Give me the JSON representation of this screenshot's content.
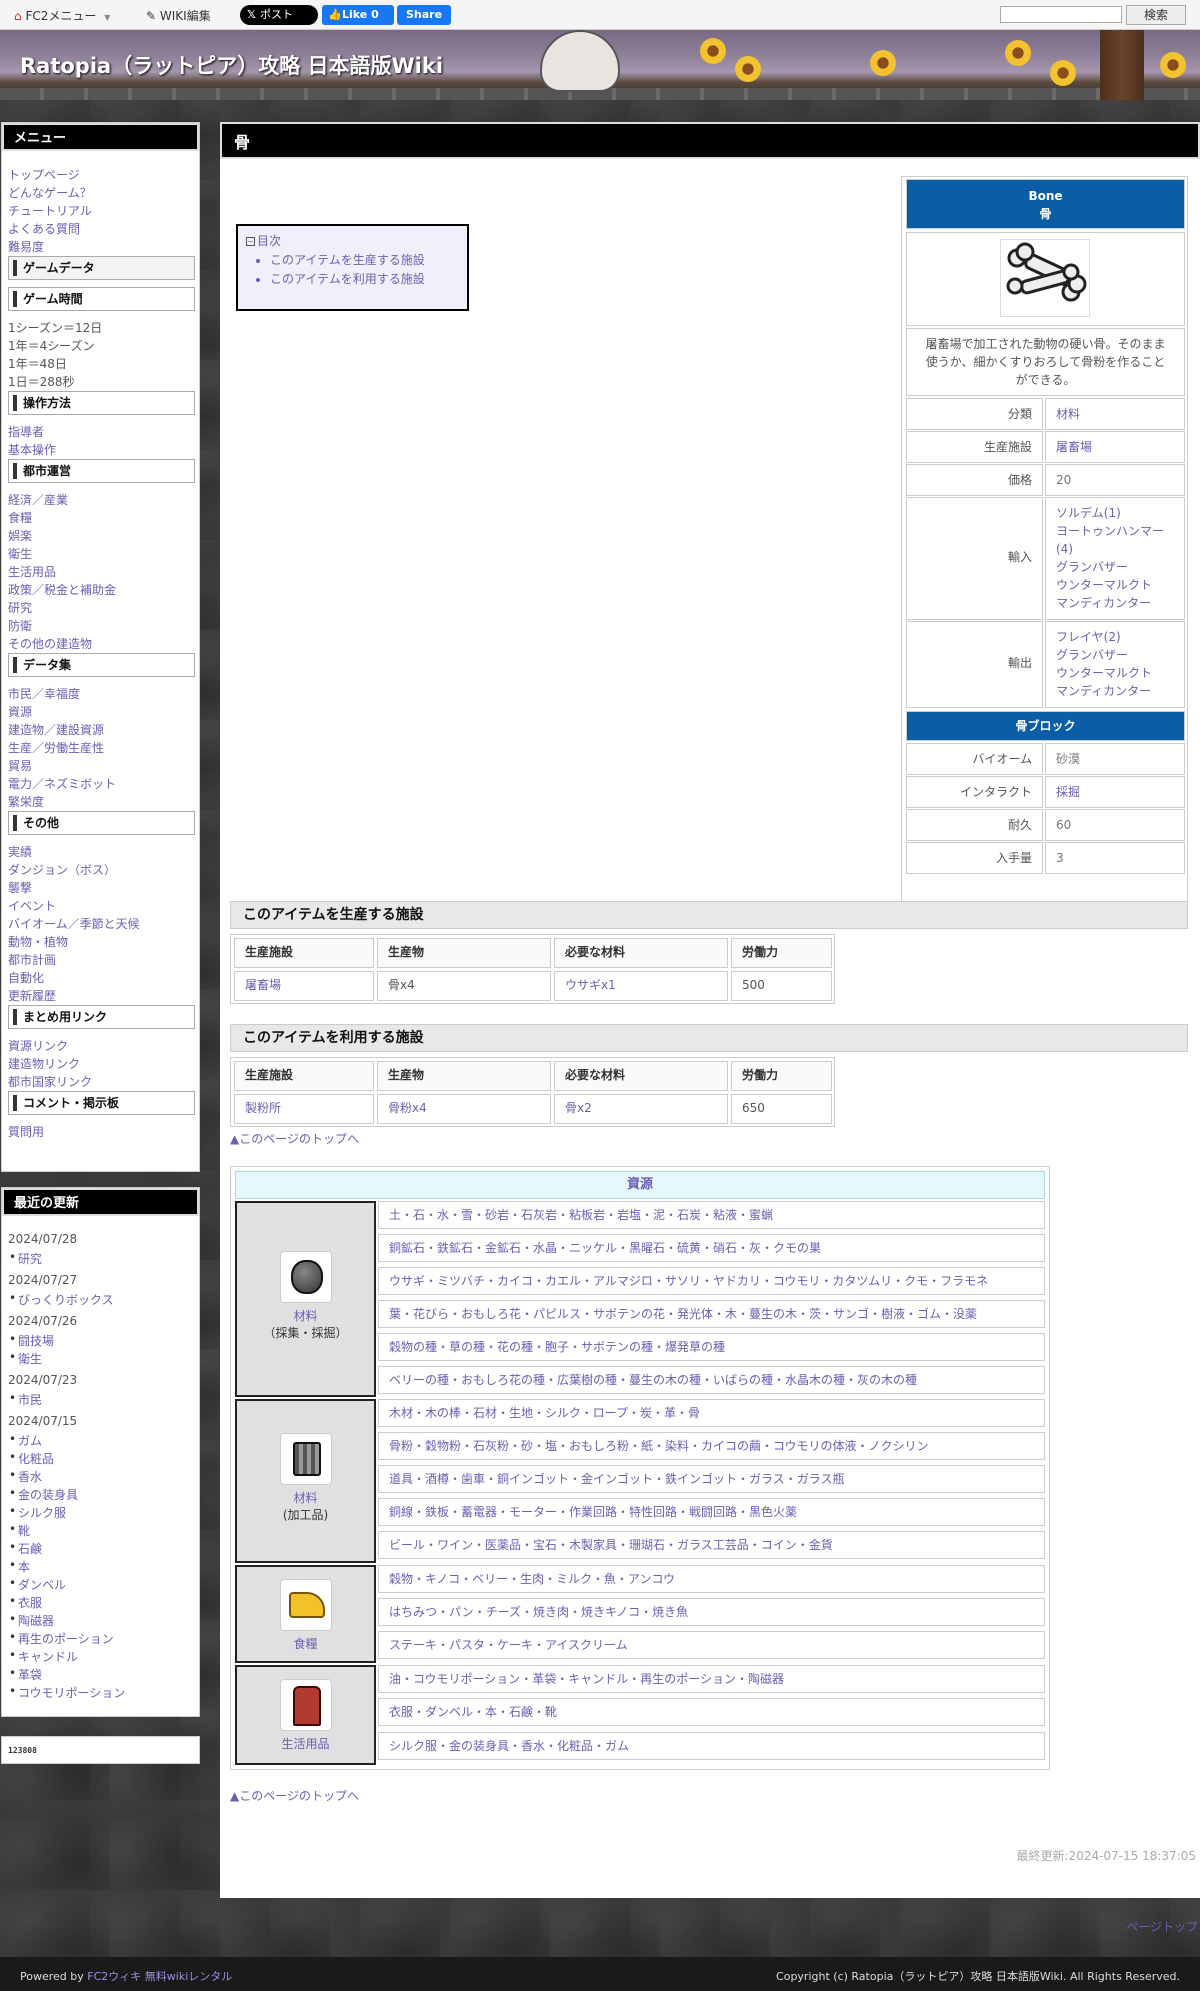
{
  "topbar": {
    "fc2_menu": "FC2メニュー",
    "wiki_edit": "WIKI編集",
    "post": "ポスト",
    "like": "Like 0",
    "share": "Share",
    "search_button": "検索",
    "search_value": ""
  },
  "header": {
    "title": "Ratopia（ラットピア）攻略 日本語版Wiki"
  },
  "sidebar": {
    "menu_title": "メニュー",
    "links_top": [
      "トップページ",
      "どんなゲーム？",
      "チュートリアル",
      "よくある質問",
      "難易度"
    ],
    "game_data": "ゲームデータ",
    "game_time": "ゲーム時間",
    "time_lines": [
      "1シーズン＝12日",
      "1年＝4シーズン",
      "1年＝48日",
      "1日＝288秒"
    ],
    "controls": "操作方法",
    "controls_links": [
      "指導者",
      "基本操作"
    ],
    "city": "都市運営",
    "city_links": [
      "経済／産業",
      "食糧",
      "娯楽",
      "衛生",
      "生活用品",
      "政策／税金と補助金",
      "研究",
      "防衛",
      "その他の建造物"
    ],
    "dataset": "データ集",
    "dataset_links": [
      "市民／幸福度",
      "資源",
      "建造物／建設資源",
      "生産／労働生産性",
      "貿易",
      "電力／ネズミボット",
      "繁栄度"
    ],
    "other": "その他",
    "other_links": [
      "実績",
      "ダンジョン（ボス）",
      "襲撃",
      "イベント",
      "バイオーム／季節と天候",
      "動物・植物",
      "都市計画",
      "自動化",
      "更新履歴"
    ],
    "summary": "まとめ用リンク",
    "summary_links": [
      "資源リンク",
      "建造物リンク",
      "都市国家リンク"
    ],
    "comment": "コメント・掲示板",
    "comment_links": [
      "質問用"
    ],
    "recent_title": "最近の更新",
    "recent": [
      {
        "date": "2024/07/28",
        "items": [
          "研究"
        ]
      },
      {
        "date": "2024/07/27",
        "items": [
          "びっくりボックス"
        ]
      },
      {
        "date": "2024/07/26",
        "items": [
          "闘技場",
          "衛生"
        ]
      },
      {
        "date": "2024/07/23",
        "items": [
          "市民"
        ]
      },
      {
        "date": "2024/07/15",
        "items": [
          "ガム",
          "化粧品",
          "香水",
          "金の装身具",
          "シルク服",
          "靴",
          "石鹸",
          "本",
          "ダンベル",
          "衣服",
          "陶磁器",
          "再生のポーション",
          "キャンドル",
          "革袋",
          "コウモリポーション"
        ]
      }
    ],
    "counter": "123808"
  },
  "main": {
    "title": "骨",
    "toc_label": "目次",
    "toc": [
      "このアイテムを生産する施設",
      "このアイテムを利用する施設"
    ],
    "infobox": {
      "name_en": "Bone",
      "name_jp": "骨",
      "desc": "屠畜場で加工された動物の硬い骨。そのまま使うか、細かくすりおろして骨粉を作ることができる。",
      "rows": [
        {
          "label": "分類",
          "value": "材料",
          "link": true
        },
        {
          "label": "生産施設",
          "value": "屠畜場",
          "link": true
        },
        {
          "label": "価格",
          "value": "20",
          "link": false
        }
      ],
      "import_label": "輸入",
      "import": [
        "ソルデム(1)",
        "ヨートゥンハンマー(4)",
        "グランバザー",
        "ウンターマルクト",
        "マンディカンター"
      ],
      "export_label": "輸出",
      "export": [
        "フレイヤ(2)",
        "グランバザー",
        "ウンターマルクト",
        "マンディカンター"
      ],
      "block_title": "骨ブロック",
      "block_rows": [
        {
          "label": "バイオーム",
          "value": "砂漠",
          "link": false
        },
        {
          "label": "インタラクト",
          "value": "採掘",
          "link": true
        },
        {
          "label": "耐久",
          "value": "60",
          "link": false
        },
        {
          "label": "入手量",
          "value": "3",
          "link": false
        }
      ]
    },
    "produce_title": "このアイテムを生産する施設",
    "use_title": "このアイテムを利用する施設",
    "table_headers": [
      "生産施設",
      "生産物",
      "必要な材料",
      "労働力"
    ],
    "produce_row": [
      "屠畜場",
      "骨x4",
      "ウサギx1",
      "500"
    ],
    "use_row": [
      "製粉所",
      "骨粉x4",
      "骨x2",
      "650"
    ],
    "top_link": "▲このページのトップへ",
    "resources": {
      "title": "資源",
      "cat1_name": "材料",
      "cat1_sub": "（採集・採掘）",
      "cat2_name": "材料",
      "cat2_sub": "(加工品)",
      "cat3_name": "食糧",
      "cat4_name": "生活用品",
      "rows": [
        "土・石・水・雪・砂岩・石灰岩・粘板岩・岩塩・泥・石炭・粘液・蜜蝋",
        "銅鉱石・鉄鉱石・金鉱石・水晶・ニッケル・黒曜石・硫黄・硝石・灰・クモの巣",
        "ウサギ・ミツバチ・カイコ・カエル・アルマジロ・サソリ・ヤドカリ・コウモリ・カタツムリ・クモ・フラモネ",
        "葉・花びら・おもしろ花・パピルス・サボテンの花・発光体・木・蔓生の木・茨・サンゴ・樹液・ゴム・没薬",
        "穀物の種・草の種・花の種・胞子・サボテンの種・爆発草の種",
        "ベリーの種・おもしろ花の種・広葉樹の種・蔓生の木の種・いばらの種・水晶木の種・灰の木の種",
        "木材・木の棒・石材・生地・シルク・ロープ・炭・革・骨",
        "骨粉・穀物粉・石灰粉・砂・塩・おもしろ粉・紙・染料・カイコの繭・コウモリの体液・ノクシリン",
        "道具・酒樽・歯車・銅インゴット・金インゴット・鉄インゴット・ガラス・ガラス瓶",
        "銅線・鉄板・蓄電器・モーター・作業回路・特性回路・戦闘回路・黒色火薬",
        "ビール・ワイン・医薬品・宝石・木製家具・珊瑚石・ガラス工芸品・コイン・金貨",
        "穀物・キノコ・ベリー・生肉・ミルク・魚・アンコウ",
        "はちみつ・パン・チーズ・焼き肉・焼きキノコ・焼き魚",
        "ステーキ・パスタ・ケーキ・アイスクリーム",
        "油・コウモリポーション・革袋・キャンドル・再生のポーション・陶磁器",
        "衣服・ダンベル・本・石鹸・靴",
        "シルク服・金の装身具・香水・化粧品・ガム"
      ]
    },
    "last_updated": "最終更新:2024-07-15 18:37:05"
  },
  "footer": {
    "powered_prefix": "Powered by ",
    "powered_link": "FC2ウィキ 無料wikiレンタル",
    "copyright": "Copyright (c) Ratopia（ラットピア）攻略 日本語版Wiki. All Rights Reserved.",
    "page_top": "ページトップ"
  }
}
